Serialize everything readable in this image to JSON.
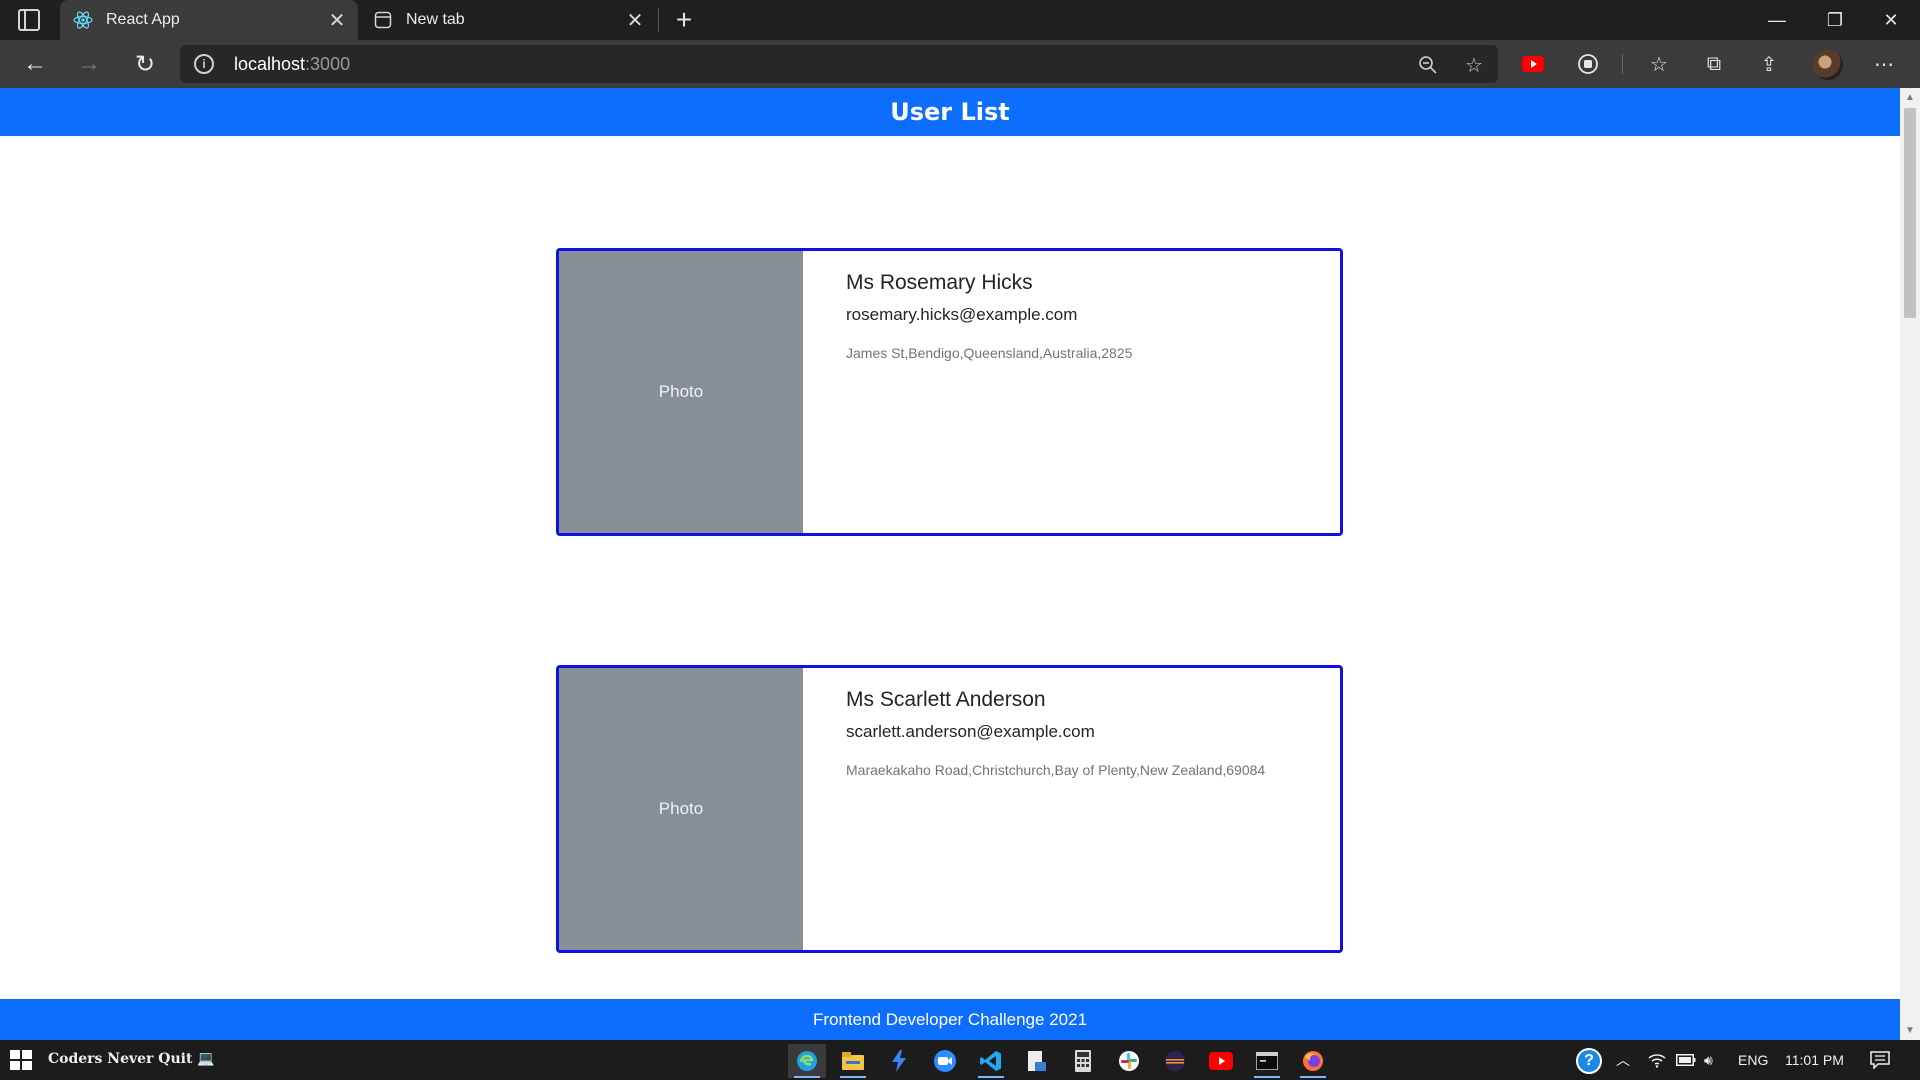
{
  "browser": {
    "tabs": [
      {
        "title": "React App",
        "favicon": "react-icon",
        "active": true
      },
      {
        "title": "New tab",
        "favicon": "newtab-icon",
        "active": false
      }
    ],
    "url_host": "localhost",
    "url_port": ":3000"
  },
  "page": {
    "header_title": "User List",
    "footer_text": "Frontend Developer Challenge 2021",
    "users": [
      {
        "photo_label": "Photo",
        "name": "Ms Rosemary Hicks",
        "email": "rosemary.hicks@example.com",
        "address": "James St,Bendigo,Queensland,Australia,2825"
      },
      {
        "photo_label": "Photo",
        "name": "Ms Scarlett Anderson",
        "email": "scarlett.anderson@example.com",
        "address": "Maraekakaho Road,Christchurch,Bay of Plenty,New Zealand,69084"
      }
    ]
  },
  "taskbar": {
    "label": "Coders Never Quit 💻",
    "language": "ENG",
    "time": "11:01 PM"
  },
  "colors": {
    "primary": "#0d6efd",
    "card_border": "#1010e0",
    "photo_bg": "#868e96"
  }
}
